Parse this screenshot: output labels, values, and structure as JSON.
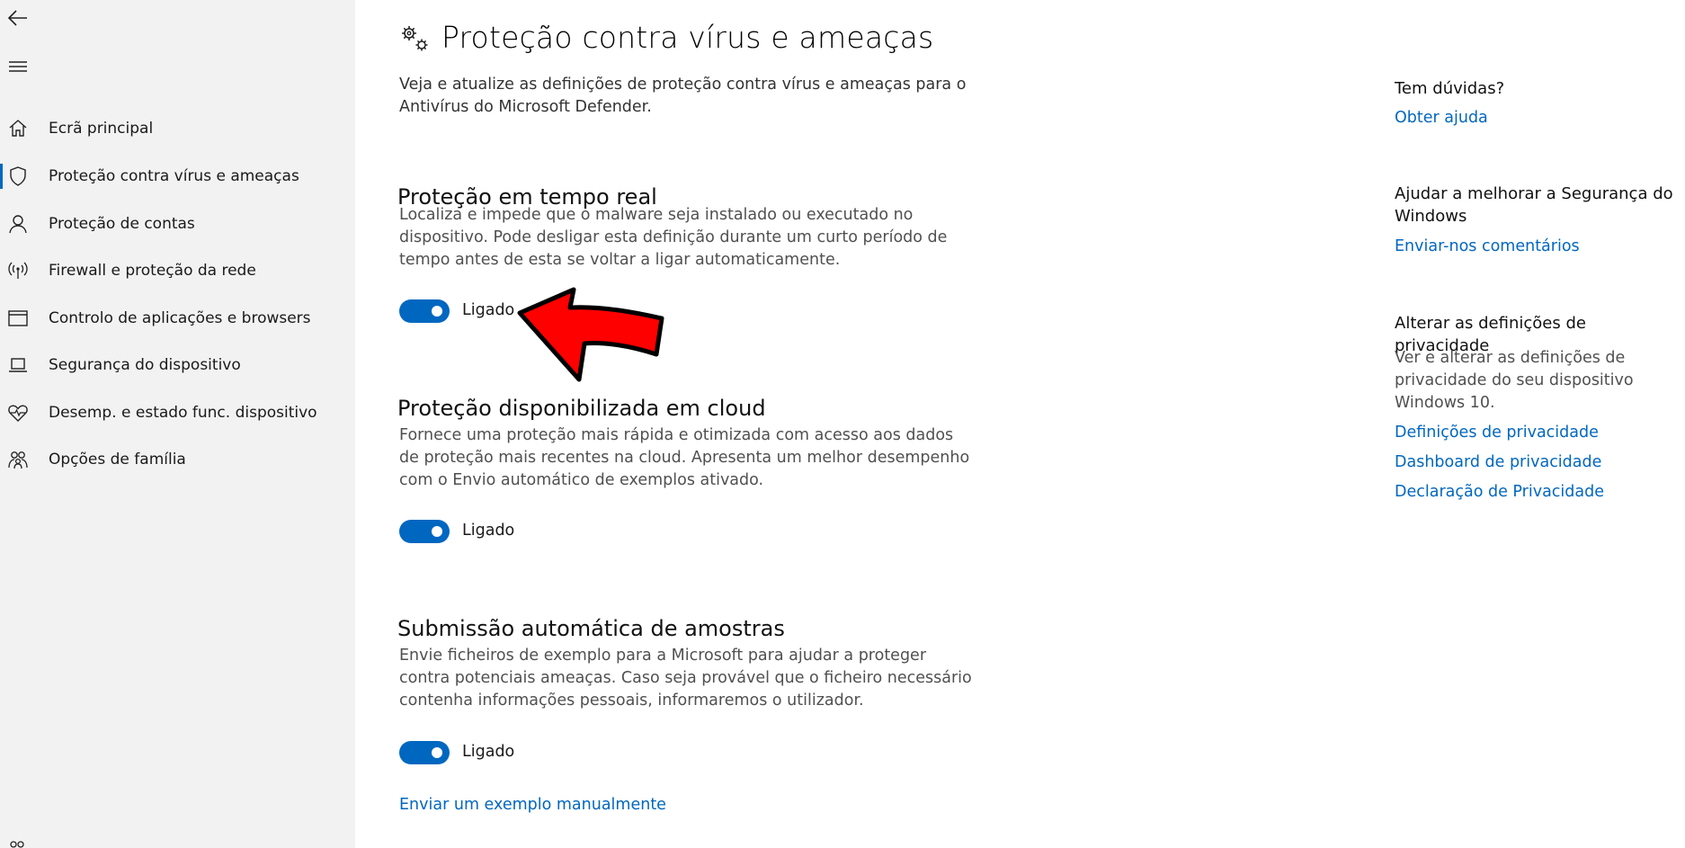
{
  "sidebar": {
    "icons": {
      "back": "back-arrow-icon",
      "menu": "hamburger-menu-icon"
    },
    "items": [
      {
        "label": "Ecrã principal",
        "icon": "home-icon",
        "selected": false
      },
      {
        "label": "Proteção contra vírus e ameaças",
        "icon": "shield-icon",
        "selected": true
      },
      {
        "label": "Proteção de contas",
        "icon": "person-icon",
        "selected": false
      },
      {
        "label": "Firewall e proteção da rede",
        "icon": "antenna-icon",
        "selected": false
      },
      {
        "label": "Controlo de aplicações e browsers",
        "icon": "app-window-icon",
        "selected": false
      },
      {
        "label": "Segurança do dispositivo",
        "icon": "laptop-icon",
        "selected": false
      },
      {
        "label": "Desemp. e estado func. dispositivo",
        "icon": "heart-pulse-icon",
        "selected": false
      },
      {
        "label": "Opções de família",
        "icon": "family-icon",
        "selected": false
      }
    ]
  },
  "main": {
    "title": "Proteção contra vírus e ameaças",
    "title_icon": "gears-icon",
    "intro": "Veja e atualize as definições de proteção contra vírus e ameaças para o Antivírus do Microsoft Defender.",
    "sections": [
      {
        "title": "Proteção em tempo real",
        "description": "Localiza e impede que o malware seja instalado ou executado no dispositivo. Pode desligar esta definição durante um curto período de tempo antes de esta se voltar a ligar automaticamente.",
        "toggle_label": "Ligado",
        "toggle_on": true
      },
      {
        "title": "Proteção disponibilizada em cloud",
        "description": "Fornece uma proteção mais rápida e otimizada com acesso aos dados de proteção mais recentes na cloud. Apresenta um melhor desempenho com o Envio automático de exemplos ativado.",
        "toggle_label": "Ligado",
        "toggle_on": true
      },
      {
        "title": "Submissão automática de amostras",
        "description": "Envie ficheiros de exemplo para a Microsoft para ajudar a proteger contra potenciais ameaças. Caso seja provável que o ficheiro necessário contenha informações pessoais, informaremos o utilizador.",
        "toggle_label": "Ligado",
        "toggle_on": true
      }
    ],
    "manual_link": "Enviar um exemplo manualmente"
  },
  "right_column": {
    "help": {
      "heading": "Tem dúvidas?",
      "link": "Obter ajuda"
    },
    "improve": {
      "heading": "Ajudar a melhorar a Segurança do Windows",
      "link": "Enviar-nos comentários"
    },
    "privacy": {
      "heading": "Alterar as definições de privacidade",
      "text": "Ver e alterar as definições de privacidade do seu dispositivo Windows 10.",
      "links": [
        "Definições de privacidade",
        "Dashboard de privacidade",
        "Declaração de Privacidade"
      ]
    }
  },
  "colors": {
    "accent": "#0067c0",
    "sidebar_bg": "#f2f2f2",
    "annotation_arrow": "#ff0000"
  }
}
